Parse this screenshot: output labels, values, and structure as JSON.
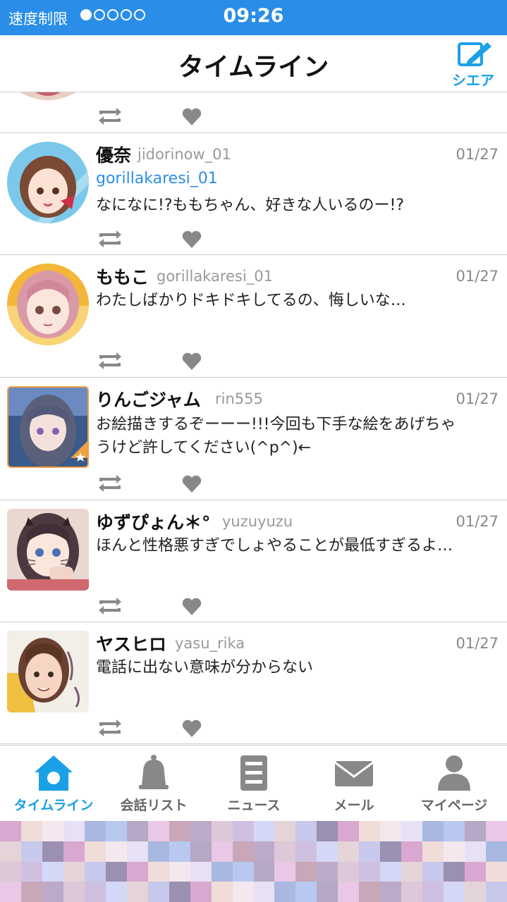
{
  "status_bar": {
    "limit_label": "速度制限",
    "time": "09:26",
    "signal_level": 1,
    "signal_max": 5
  },
  "header": {
    "title": "タイムライン",
    "share_label": "シエア"
  },
  "posts": [
    {
      "name": "優奈",
      "handle": "jidorinow_01",
      "date": "01/27",
      "reply_to": "gorillakaresi_01",
      "text": [
        "なになに!?ももちゃん、好きな人いるのー!?"
      ]
    },
    {
      "name": "ももこ",
      "handle": "gorillakaresi_01",
      "date": "01/27",
      "text": [
        "わたしばかりドキドキしてるの、悔しいな…"
      ]
    },
    {
      "name": "りんごジャム",
      "handle": "rin555",
      "date": "01/27",
      "text": [
        "お絵描きするぞーーー!!!今回も下手な絵をあげちゃ",
        "うけど許してください(^p^)←"
      ]
    },
    {
      "name": "ゆずぴょん＊°",
      "handle": "yuzuyuzu",
      "date": "01/27",
      "text": [
        "ほんと性格悪すぎでしょやることが最低すぎるよ…"
      ]
    },
    {
      "name": "ヤスヒロ",
      "handle": "yasu_rika",
      "date": "01/27",
      "text": [
        "電話に出ない意味が分からない"
      ]
    }
  ],
  "nav": [
    {
      "label": "タイムライン",
      "icon": "home-icon",
      "active": true
    },
    {
      "label": "会話リスト",
      "icon": "bell-icon",
      "active": false
    },
    {
      "label": "ニュース",
      "icon": "news-icon",
      "active": false
    },
    {
      "label": "メール",
      "icon": "mail-icon",
      "active": false
    },
    {
      "label": "マイページ",
      "icon": "person-icon",
      "active": false
    }
  ],
  "colors": {
    "accent": "#1aa0e6",
    "status_bar": "#2a8ee8",
    "icon_gray": "#888888"
  }
}
